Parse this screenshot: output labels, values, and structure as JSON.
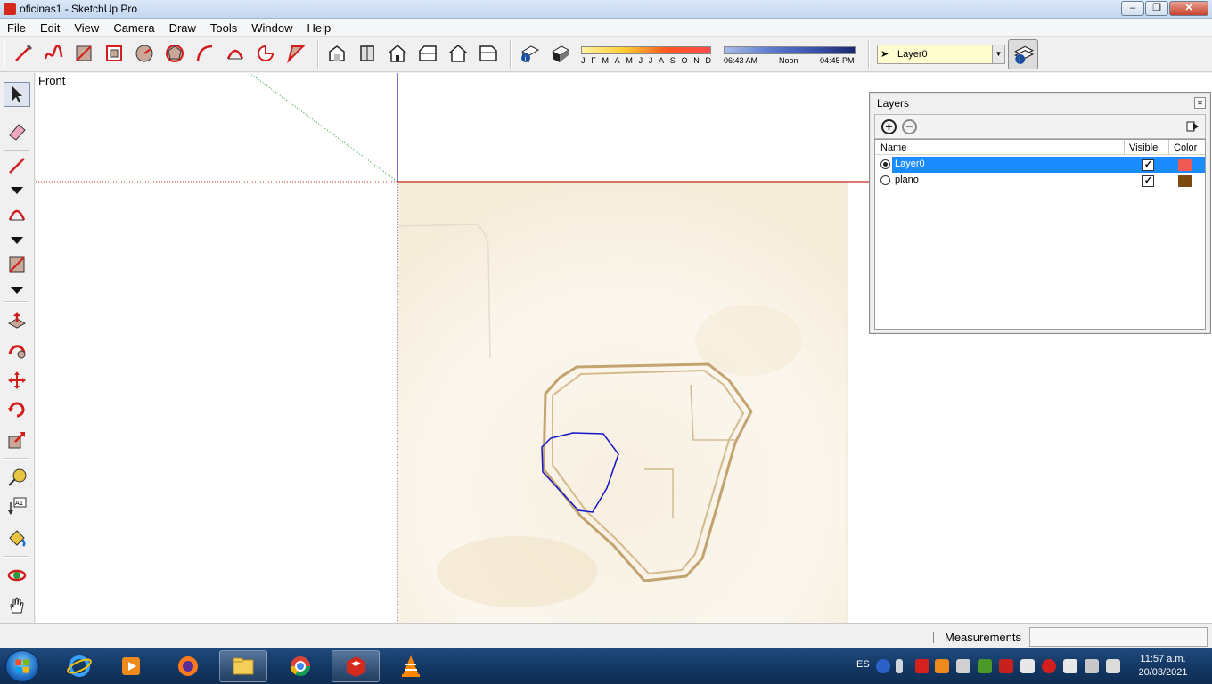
{
  "window": {
    "title": "oficinas1 - SketchUp Pro"
  },
  "menu": [
    "File",
    "Edit",
    "View",
    "Camera",
    "Draw",
    "Tools",
    "Window",
    "Help"
  ],
  "toolbar": {
    "months": [
      "J",
      "F",
      "M",
      "A",
      "M",
      "J",
      "J",
      "A",
      "S",
      "O",
      "N",
      "D"
    ],
    "time_start": "06:43 AM",
    "time_mid": "Noon",
    "time_end": "04:45 PM",
    "current_layer": "Layer0"
  },
  "viewport": {
    "scene_label": "Front"
  },
  "layers_dialog": {
    "title": "Layers",
    "columns": {
      "name": "Name",
      "visible": "Visible",
      "color": "Color"
    },
    "rows": [
      {
        "name": "Layer0",
        "active": true,
        "visible": true,
        "color": "#f05a55"
      },
      {
        "name": "plano",
        "active": false,
        "visible": true,
        "color": "#7a4a10"
      }
    ]
  },
  "statusbar": {
    "measurements_label": "Measurements"
  },
  "taskbar": {
    "language": "ES",
    "time": "11:57 a.m.",
    "date": "20/03/2021"
  }
}
